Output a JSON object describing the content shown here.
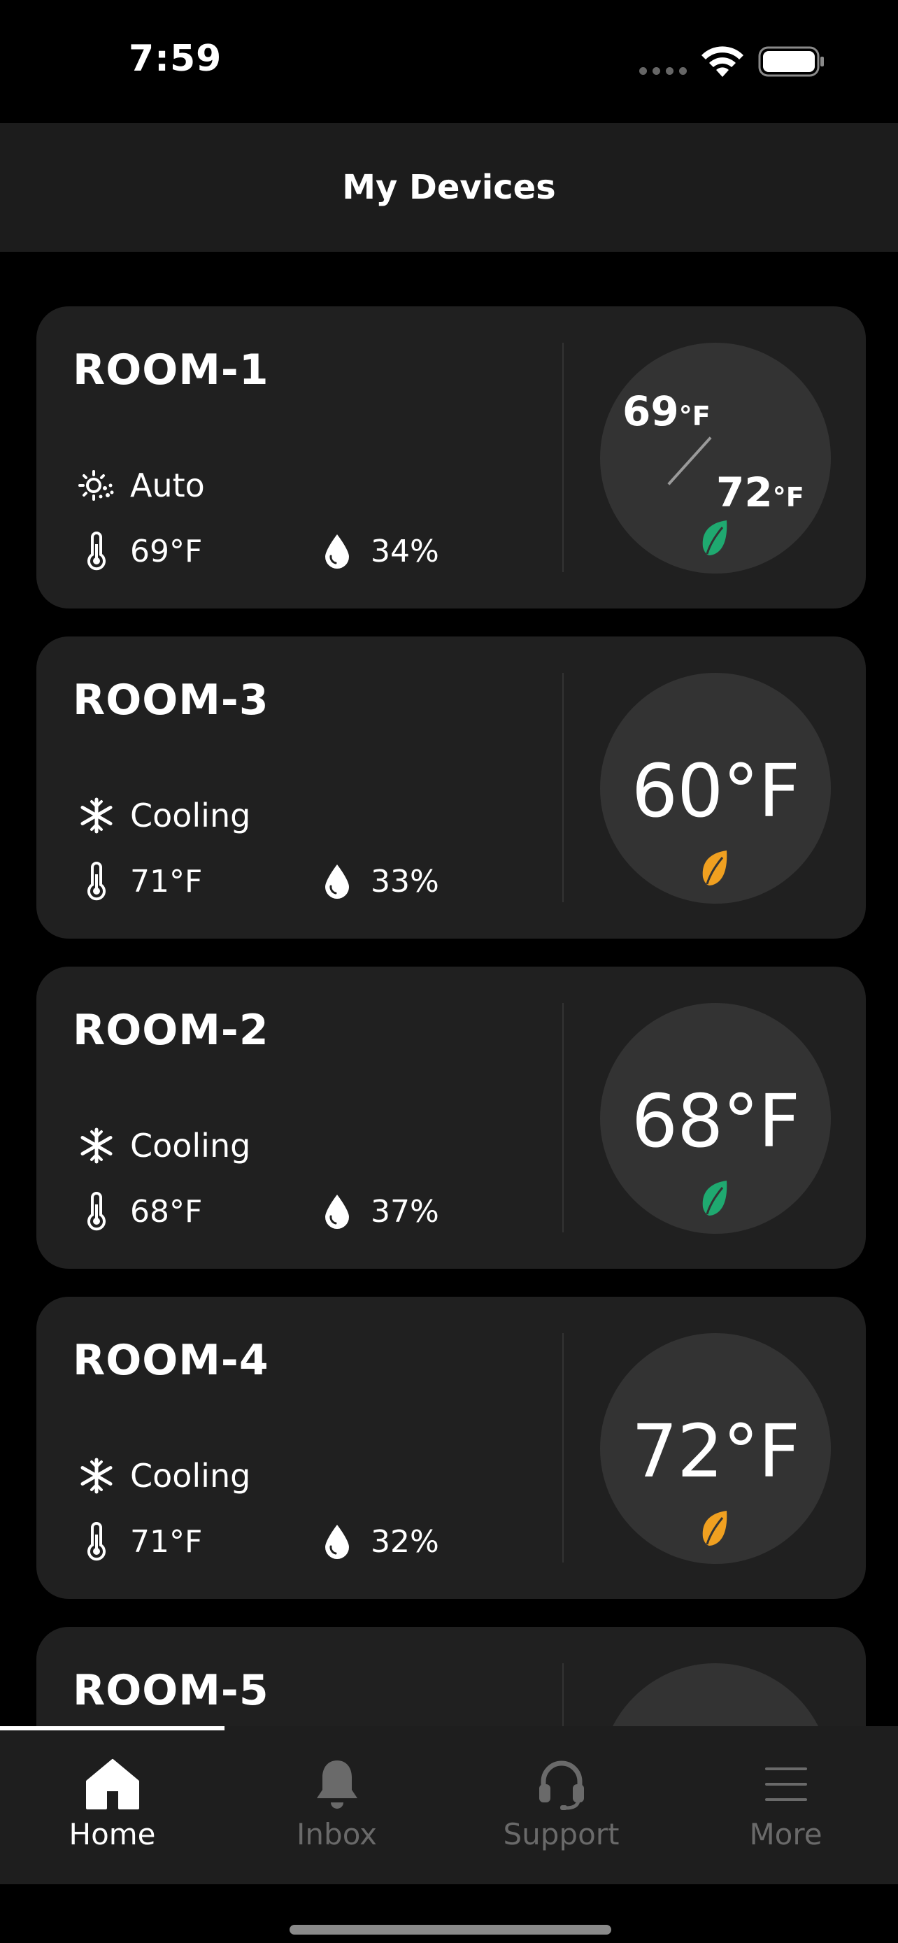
{
  "status_bar": {
    "time": "7:59"
  },
  "header": {
    "title": "My Devices"
  },
  "devices": [
    {
      "name": "ROOM-1",
      "mode": "Auto",
      "mode_icon": "auto-sun-snow-icon",
      "temperature": "69°F",
      "humidity": "34%",
      "dual_setpoint": true,
      "heat_setpoint": "69",
      "heat_unit": "°F",
      "cool_setpoint": "72",
      "cool_unit": "°F",
      "leaf_color": "#1fa970"
    },
    {
      "name": "ROOM-3",
      "mode": "Cooling",
      "mode_icon": "snowflake-icon",
      "temperature": "71°F",
      "humidity": "33%",
      "setpoint": "60°F",
      "leaf_color": "#f0a020"
    },
    {
      "name": "ROOM-2",
      "mode": "Cooling",
      "mode_icon": "snowflake-icon",
      "temperature": "68°F",
      "humidity": "37%",
      "setpoint": "68°F",
      "leaf_color": "#1fa970"
    },
    {
      "name": "ROOM-4",
      "mode": "Cooling",
      "mode_icon": "snowflake-icon",
      "temperature": "71°F",
      "humidity": "32%",
      "setpoint": "72°F",
      "leaf_color": "#f0a020"
    },
    {
      "name": "ROOM-5"
    }
  ],
  "tabs": [
    {
      "label": "Home",
      "icon": "home-icon",
      "active": true
    },
    {
      "label": "Inbox",
      "icon": "bell-icon",
      "active": false
    },
    {
      "label": "Support",
      "icon": "headset-icon",
      "active": false
    },
    {
      "label": "More",
      "icon": "menu-icon",
      "active": false
    }
  ],
  "colors": {
    "background": "#000000",
    "card": "#202020",
    "dial": "#333333",
    "eco_green": "#1fa970",
    "eco_orange": "#f0a020"
  }
}
